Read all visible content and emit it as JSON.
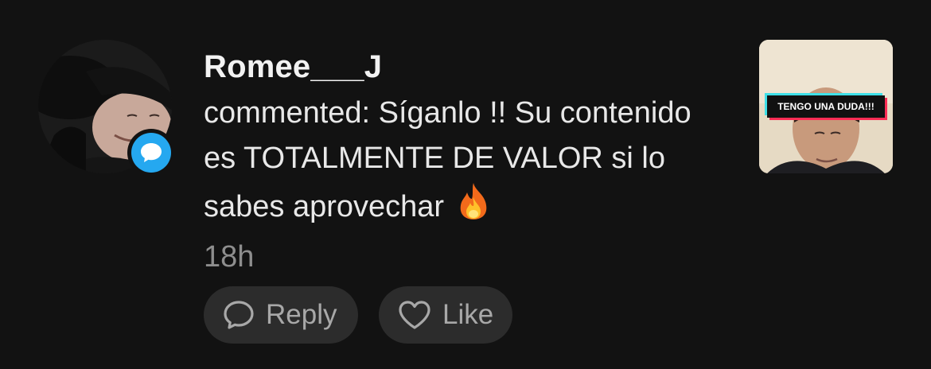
{
  "notification": {
    "username": "Romee___J",
    "comment_prefix": "commented:",
    "comment_text": "Síganlo !! Su contenido es TOTALMENTE DE VALOR si lo sabes aprovechar",
    "comment_emoji": "fire-emoji",
    "timestamp": "18h",
    "badge_icon": "comment-bubble-icon",
    "badge_color": "#25a8f0"
  },
  "actions": {
    "reply_label": "Reply",
    "reply_icon": "speech-bubble-icon",
    "like_label": "Like",
    "like_icon": "heart-outline-icon"
  },
  "thumbnail": {
    "caption": "TENGO UNA DUDA!!!"
  },
  "colors": {
    "background": "#121212",
    "pill_background": "#2c2c2c",
    "text_primary": "#f2f2f2",
    "text_secondary": "#8e8e8e"
  }
}
